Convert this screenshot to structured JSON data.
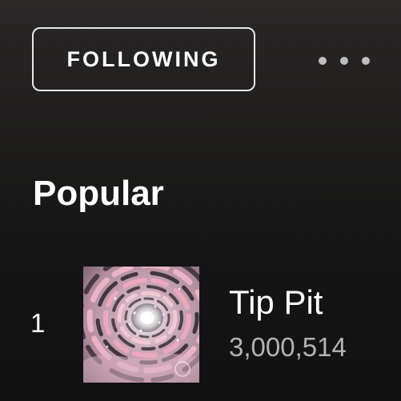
{
  "artist_actions": {
    "follow_label": "FOLLOWING",
    "more_icon": "more-horizontal-icon"
  },
  "popular": {
    "title": "Popular",
    "tracks": [
      {
        "rank": "1",
        "title": "Tip Pit",
        "plays": "3,000,514",
        "artwork_icon": "album-cover-image"
      }
    ]
  },
  "colors": {
    "background": "#121212",
    "text_primary": "#ffffff",
    "text_secondary": "#b3b3b3",
    "button_border": "#e8e8e8"
  }
}
